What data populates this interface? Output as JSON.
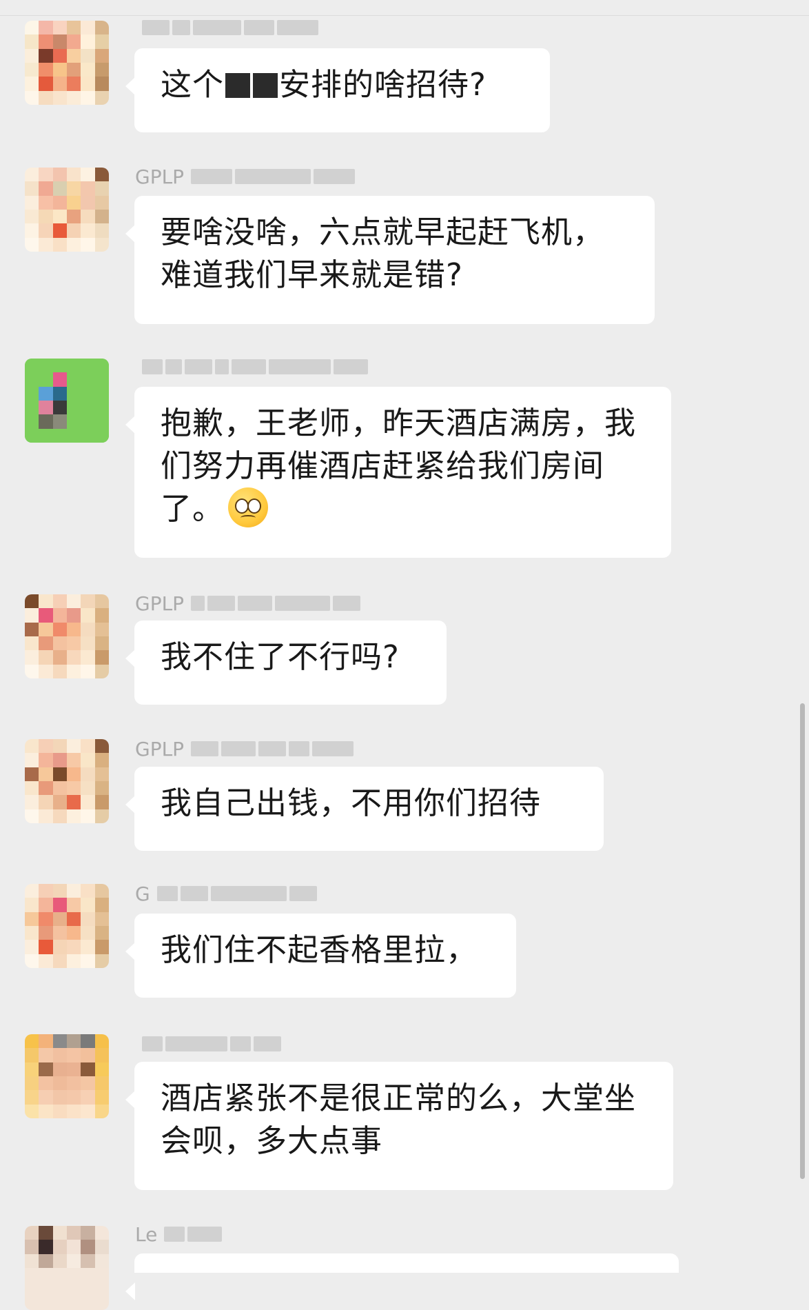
{
  "messages": [
    {
      "sender_visible": "",
      "text_before": "这个",
      "text_after": "安排的啥招待?",
      "redacted": true
    },
    {
      "sender_visible": "GPLP",
      "text": "要啥没啥，六点就早起赶飞机，难道我们早来就是错?"
    },
    {
      "sender_visible": "",
      "text": "抱歉，王老师，昨天酒店满房，我们努力再催酒店赶紧给我们房间了。",
      "emoji": "woozy-face-emoji"
    },
    {
      "sender_visible": "GPLP",
      "text": "我不住了不行吗?"
    },
    {
      "sender_visible": "GPLP",
      "text": "我自己出钱，不用你们招待"
    },
    {
      "sender_visible": "G",
      "text": "我们住不起香格里拉，"
    },
    {
      "sender_visible": "",
      "text": "酒店紧张不是很正常的么，大堂坐会呗，多大点事"
    },
    {
      "sender_visible": "Le",
      "text": ""
    }
  ]
}
